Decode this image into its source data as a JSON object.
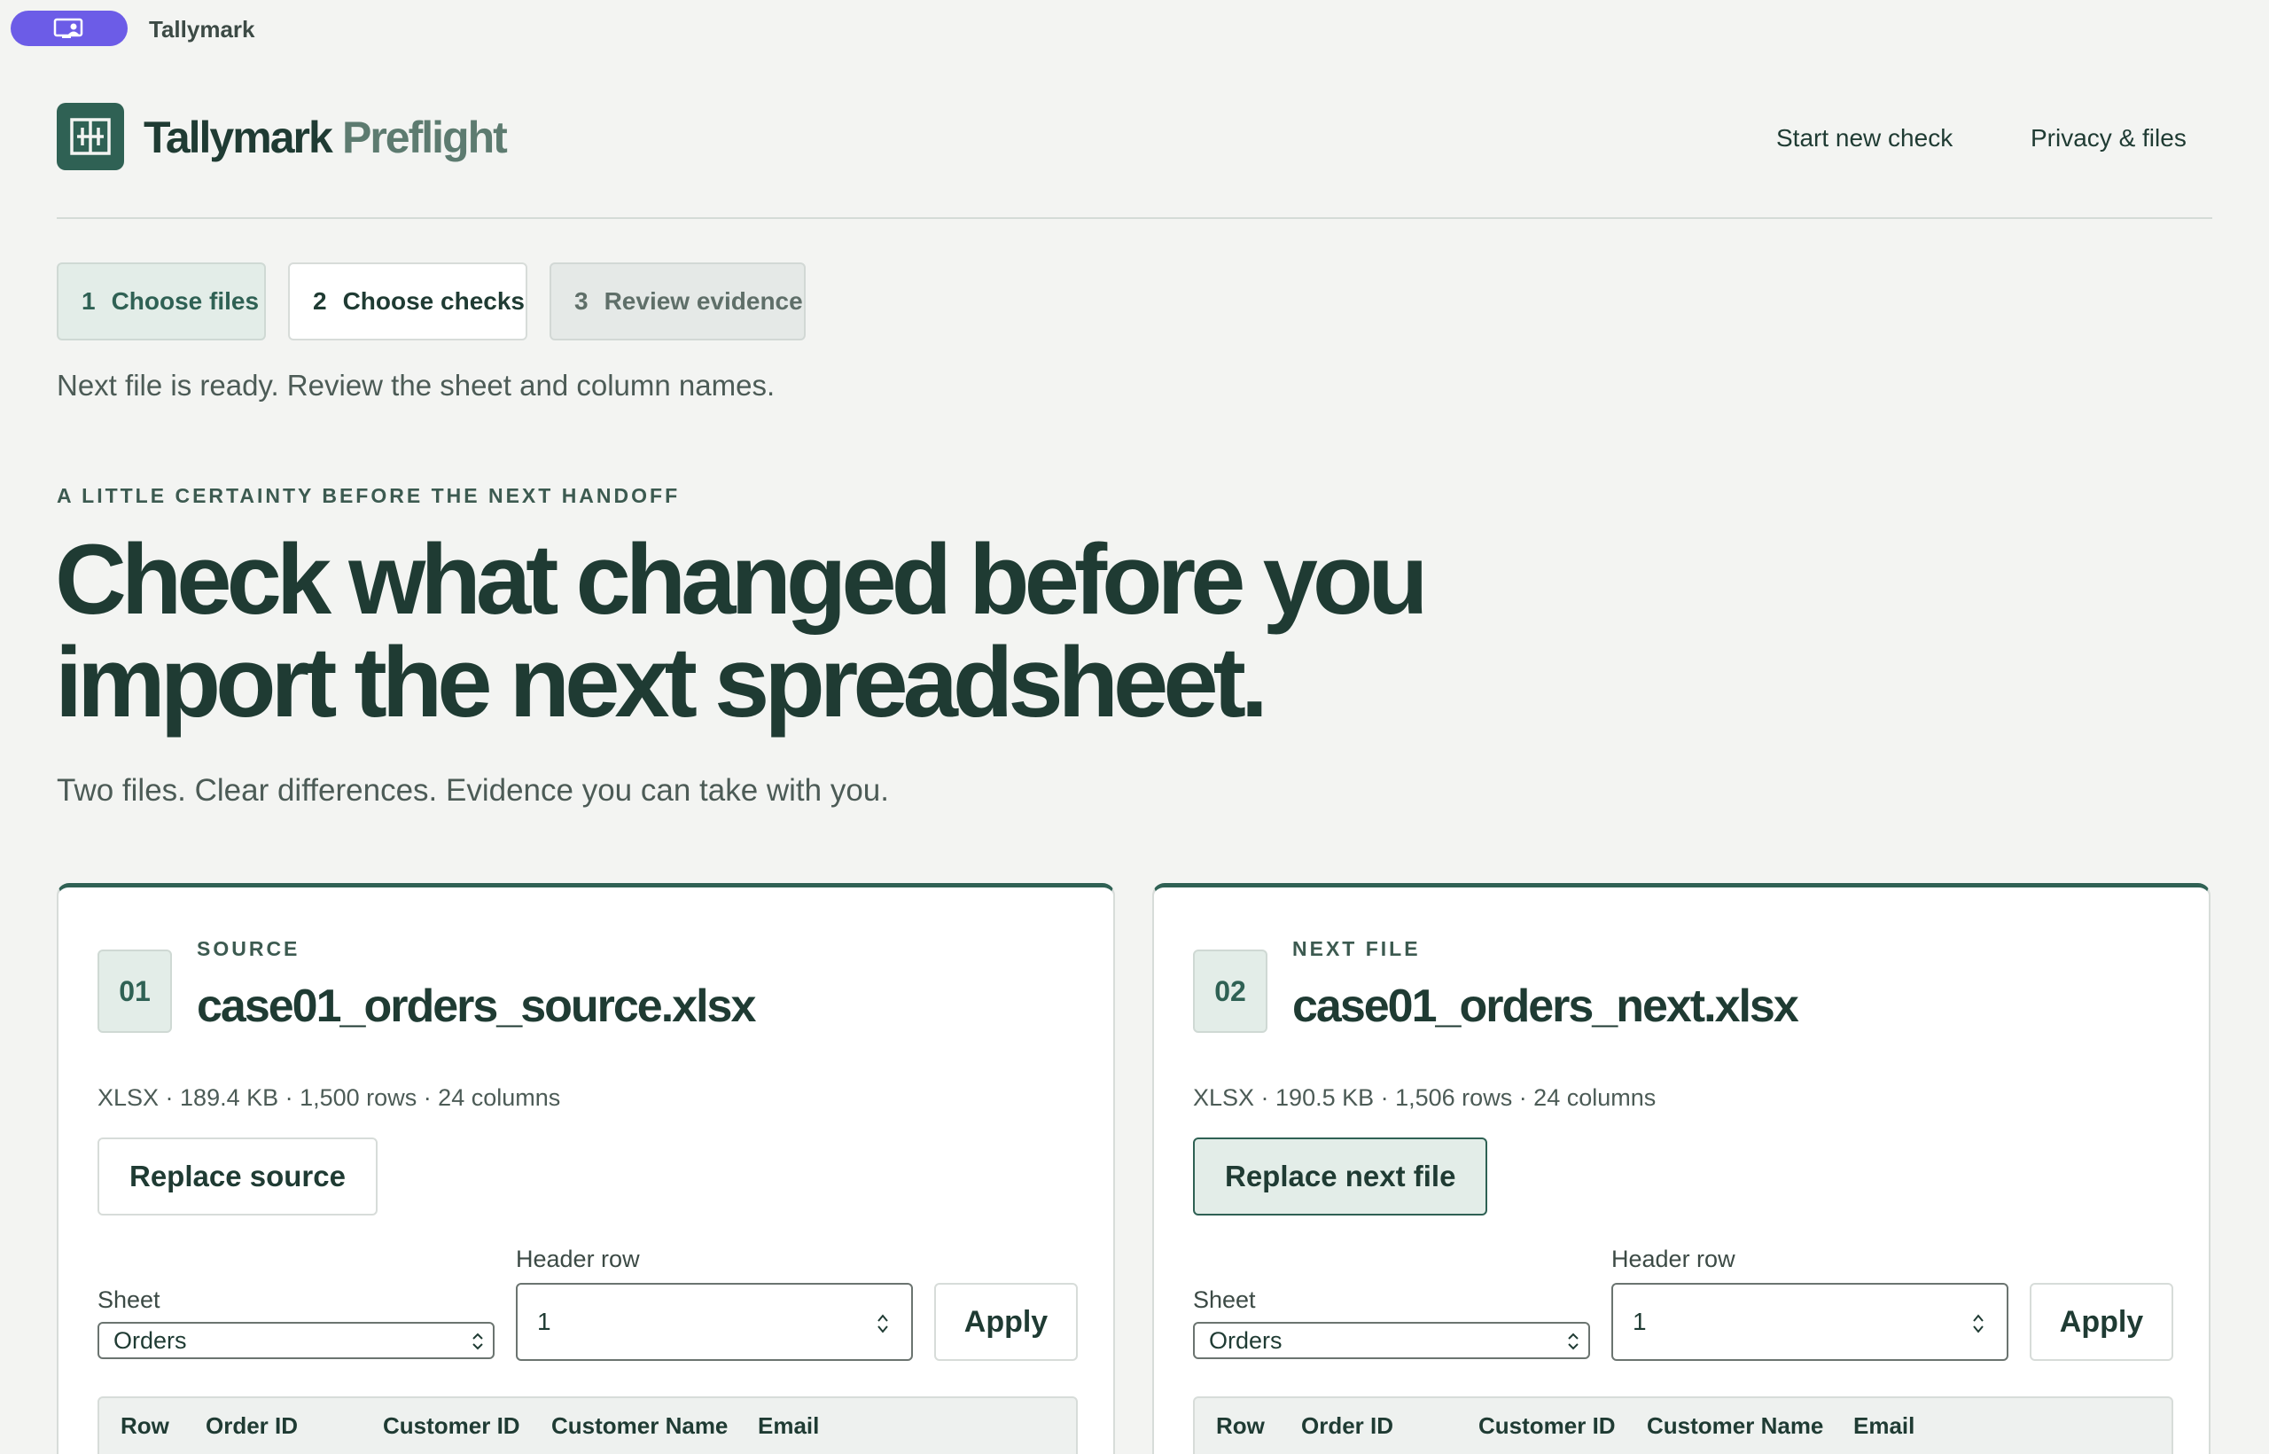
{
  "window": {
    "app_name": "Tallymark"
  },
  "header": {
    "brand_name": "Tallymark",
    "brand_sub": "Preflight",
    "nav": {
      "start_new": "Start new check",
      "privacy": "Privacy & files"
    }
  },
  "stepper": {
    "steps": [
      {
        "num": "1",
        "label": "Choose files"
      },
      {
        "num": "2",
        "label": "Choose checks"
      },
      {
        "num": "3",
        "label": "Review evidence"
      }
    ],
    "status": "Next file is ready. Review the sheet and column names."
  },
  "hero": {
    "eyebrow": "A LITTLE CERTAINTY BEFORE THE NEXT HANDOFF",
    "title_line1": "Check what changed before you",
    "title_line2": "import the next spreadsheet.",
    "subtitle": "Two files. Clear differences. Evidence you can take with you."
  },
  "cards": [
    {
      "badge": "01",
      "label": "SOURCE",
      "filename": "case01_orders_source.xlsx",
      "meta": "XLSX · 189.4 KB · 1,500 rows · 24 columns",
      "replace_label": "Replace source",
      "sheet_label": "Sheet",
      "sheet_value": "Orders",
      "header_row_label": "Header row",
      "header_row_value": "1",
      "apply_label": "Apply",
      "columns": [
        "Row",
        "Order ID",
        "Customer ID",
        "Customer Name",
        "Email"
      ]
    },
    {
      "badge": "02",
      "label": "NEXT FILE",
      "filename": "case01_orders_next.xlsx",
      "meta": "XLSX · 190.5 KB · 1,506 rows · 24 columns",
      "replace_label": "Replace next file",
      "sheet_label": "Sheet",
      "sheet_value": "Orders",
      "header_row_label": "Header row",
      "header_row_value": "1",
      "apply_label": "Apply",
      "columns": [
        "Row",
        "Order ID",
        "Customer ID",
        "Customer Name",
        "Email"
      ]
    }
  ],
  "colors": {
    "brand": "#2f6154",
    "accent_pill": "#6c5ce7",
    "background": "#f3f4f2"
  }
}
